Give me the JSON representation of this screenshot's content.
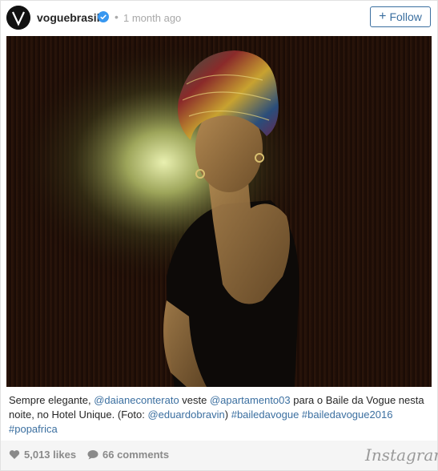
{
  "header": {
    "username": "voguebrasil",
    "separator": "•",
    "timestamp": "1 month ago",
    "follow_label": "Follow",
    "follow_plus": "+",
    "verified_icon": "verified-badge-icon",
    "verified_color": "#3897f0"
  },
  "post": {
    "image_alt": "Woman in colorful patterned turban and black dress against wooden wall",
    "caption": {
      "t1": "Sempre elegante, ",
      "m1": "@daianeconterato",
      "t2": " veste ",
      "m2": "@apartamento03",
      "t3": " para o Baile da Vogue nesta noite, no Hotel Unique. (Foto: ",
      "m3": "@eduardobravin",
      "t4": ") ",
      "h1": "#bailedavogue",
      "t5": " ",
      "h2": "#bailedavogue2016",
      "t6": " ",
      "h3": "#popafrica"
    },
    "link_color": "#3b6fa0"
  },
  "footer": {
    "likes": "5,013 likes",
    "comments": "66 comments",
    "brand": "Instagram",
    "like_icon": "heart-icon",
    "comment_icon": "speech-bubble-icon"
  }
}
